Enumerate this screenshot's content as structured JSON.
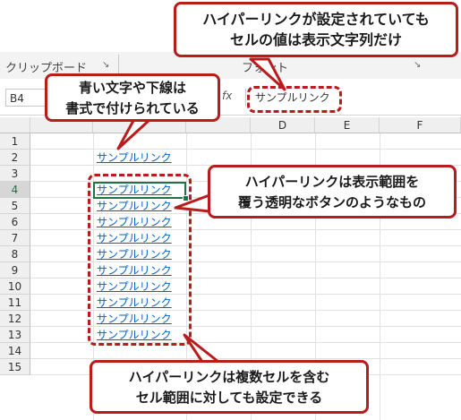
{
  "ribbon": {
    "group_clipboard": "クリップボード",
    "group_font": "フォント",
    "launcher_glyph": "↘"
  },
  "formula_bar": {
    "name_box": "B4",
    "fx_label": "fx",
    "content": "サンプルリンク"
  },
  "columns": [
    "D",
    "E",
    "F"
  ],
  "rows": [
    "1",
    "2",
    "3",
    "4",
    "5",
    "6",
    "7",
    "8",
    "9",
    "10",
    "11",
    "12",
    "13",
    "14",
    "15"
  ],
  "active_row": "4",
  "cells": {
    "B2": "サンプルリンク",
    "B4": "サンプルリンク",
    "B5": "サンプルリンク",
    "B6": "サンプルリンク",
    "B7": "サンプルリンク",
    "B8": "サンプルリンク",
    "B9": "サンプルリンク",
    "B10": "サンプルリンク",
    "B11": "サンプルリンク",
    "B12": "サンプルリンク",
    "B13": "サンプルリンク"
  },
  "callouts": {
    "top": {
      "line1": "ハイパーリンクが設定されていても",
      "line2": "セルの値は表示文字列だけ"
    },
    "left": {
      "line1": "青い文字や下線は",
      "line2": "書式で付けられている"
    },
    "right": {
      "line1": "ハイパーリンクは表示範囲を",
      "line2": "覆う透明なボタンのようなもの"
    },
    "bottom": {
      "line1": "ハイパーリンクは複数セルを含む",
      "line2": "セル範囲に対しても設定できる"
    }
  },
  "colors": {
    "accent_red": "#b81c1c",
    "link_blue": "#0563c1",
    "excel_green": "#217346"
  }
}
